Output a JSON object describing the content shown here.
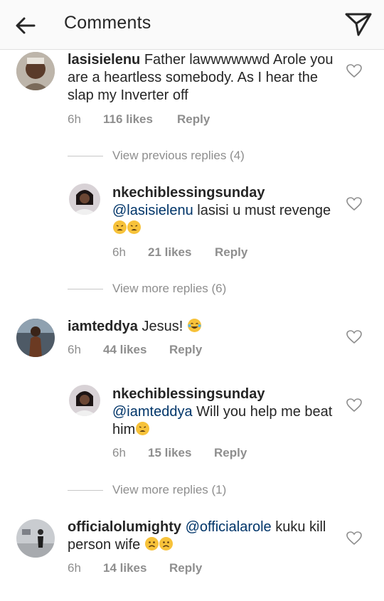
{
  "header": {
    "title": "Comments",
    "back_icon": "arrow-left-icon",
    "send_icon": "send-icon"
  },
  "comments": [
    {
      "username": "lasisielenu",
      "text": "Father lawwwwwwd Arole you are a heartless somebody. As I hear the slap my Inverter off",
      "time": "6h",
      "likes": "116 likes",
      "reply": "Reply",
      "view_replies": "View previous replies (4)"
    },
    {
      "username": "nkechiblessingsunday",
      "mention": "@lasisielenu",
      "text": " lasisi u must revenge",
      "emojis": [
        "weary-face",
        "weary-face"
      ],
      "time": "6h",
      "likes": "21 likes",
      "reply": "Reply",
      "view_replies": "View more replies (6)"
    },
    {
      "username": "iamteddya",
      "text": "Jesus!",
      "emojis": [
        "tears-of-joy-face"
      ],
      "time": "6h",
      "likes": "44 likes",
      "reply": "Reply"
    },
    {
      "username": "nkechiblessingsunday",
      "mention": "@iamteddya",
      "text": " Will you help me beat him",
      "emojis": [
        "weary-face"
      ],
      "time": "6h",
      "likes": "15 likes",
      "reply": "Reply",
      "view_replies": "View more replies (1)"
    },
    {
      "username": "officialolumighty",
      "mention": "@officialarole",
      "text": " kuku kill person wife",
      "emojis": [
        "frowning-face",
        "frowning-face"
      ],
      "time": "6h",
      "likes": "14 likes",
      "reply": "Reply"
    }
  ],
  "colors": {
    "text": "#262626",
    "meta": "#8e8e8e",
    "mention": "#003569",
    "header_bg": "#fafafa"
  }
}
